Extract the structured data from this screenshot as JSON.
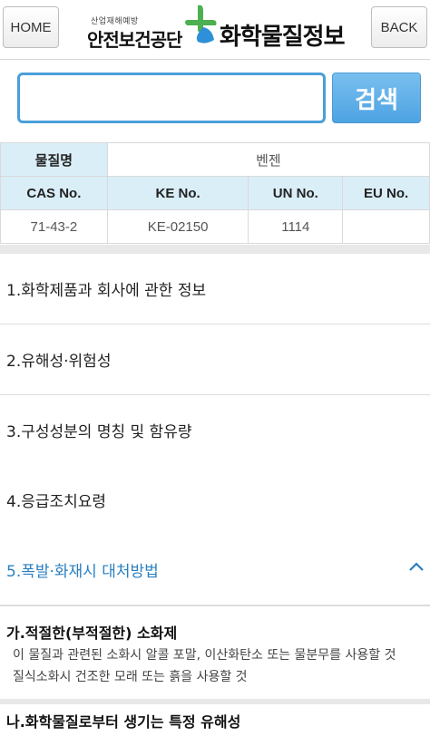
{
  "header": {
    "home_label": "HOME",
    "back_label": "BACK",
    "logo": {
      "sub": "산업재해예방",
      "org": "안전보건공단",
      "title": "화학물질정보"
    }
  },
  "search": {
    "value": "",
    "placeholder": "",
    "button_label": "검색"
  },
  "info_table": {
    "name_header": "물질명",
    "name_value": "벤젠",
    "columns": [
      "CAS No.",
      "KE No.",
      "UN No.",
      "EU No."
    ],
    "values": [
      "71-43-2",
      "KE-02150",
      "1114",
      ""
    ]
  },
  "sections": [
    {
      "label": "1.화학제품과 회사에 관한 정보"
    },
    {
      "label": "2.유해성·위험성"
    },
    {
      "label": "3.구성성분의 명칭 및 함유량"
    },
    {
      "label": "4.응급조치요령"
    },
    {
      "label": "5.폭발·화재시 대처방법",
      "expanded": true
    }
  ],
  "expanded_content": {
    "sub1_title": "가.적절한(부적절한) 소화제",
    "sub1_line1": "이 물질과 관련된 소화시 알콜 포말, 이산화탄소 또는 물분무를 사용할 것",
    "sub1_line2": "질식소화시 건조한 모래 또는 흙을 사용할 것",
    "sub2_title": "나.화학물질로부터 생기는 특정 유해성"
  },
  "colors": {
    "accent": "#4da3e2",
    "table_header_bg": "#daeef8",
    "active_section": "#2a7fc1",
    "logo_green": "#4caf50"
  }
}
